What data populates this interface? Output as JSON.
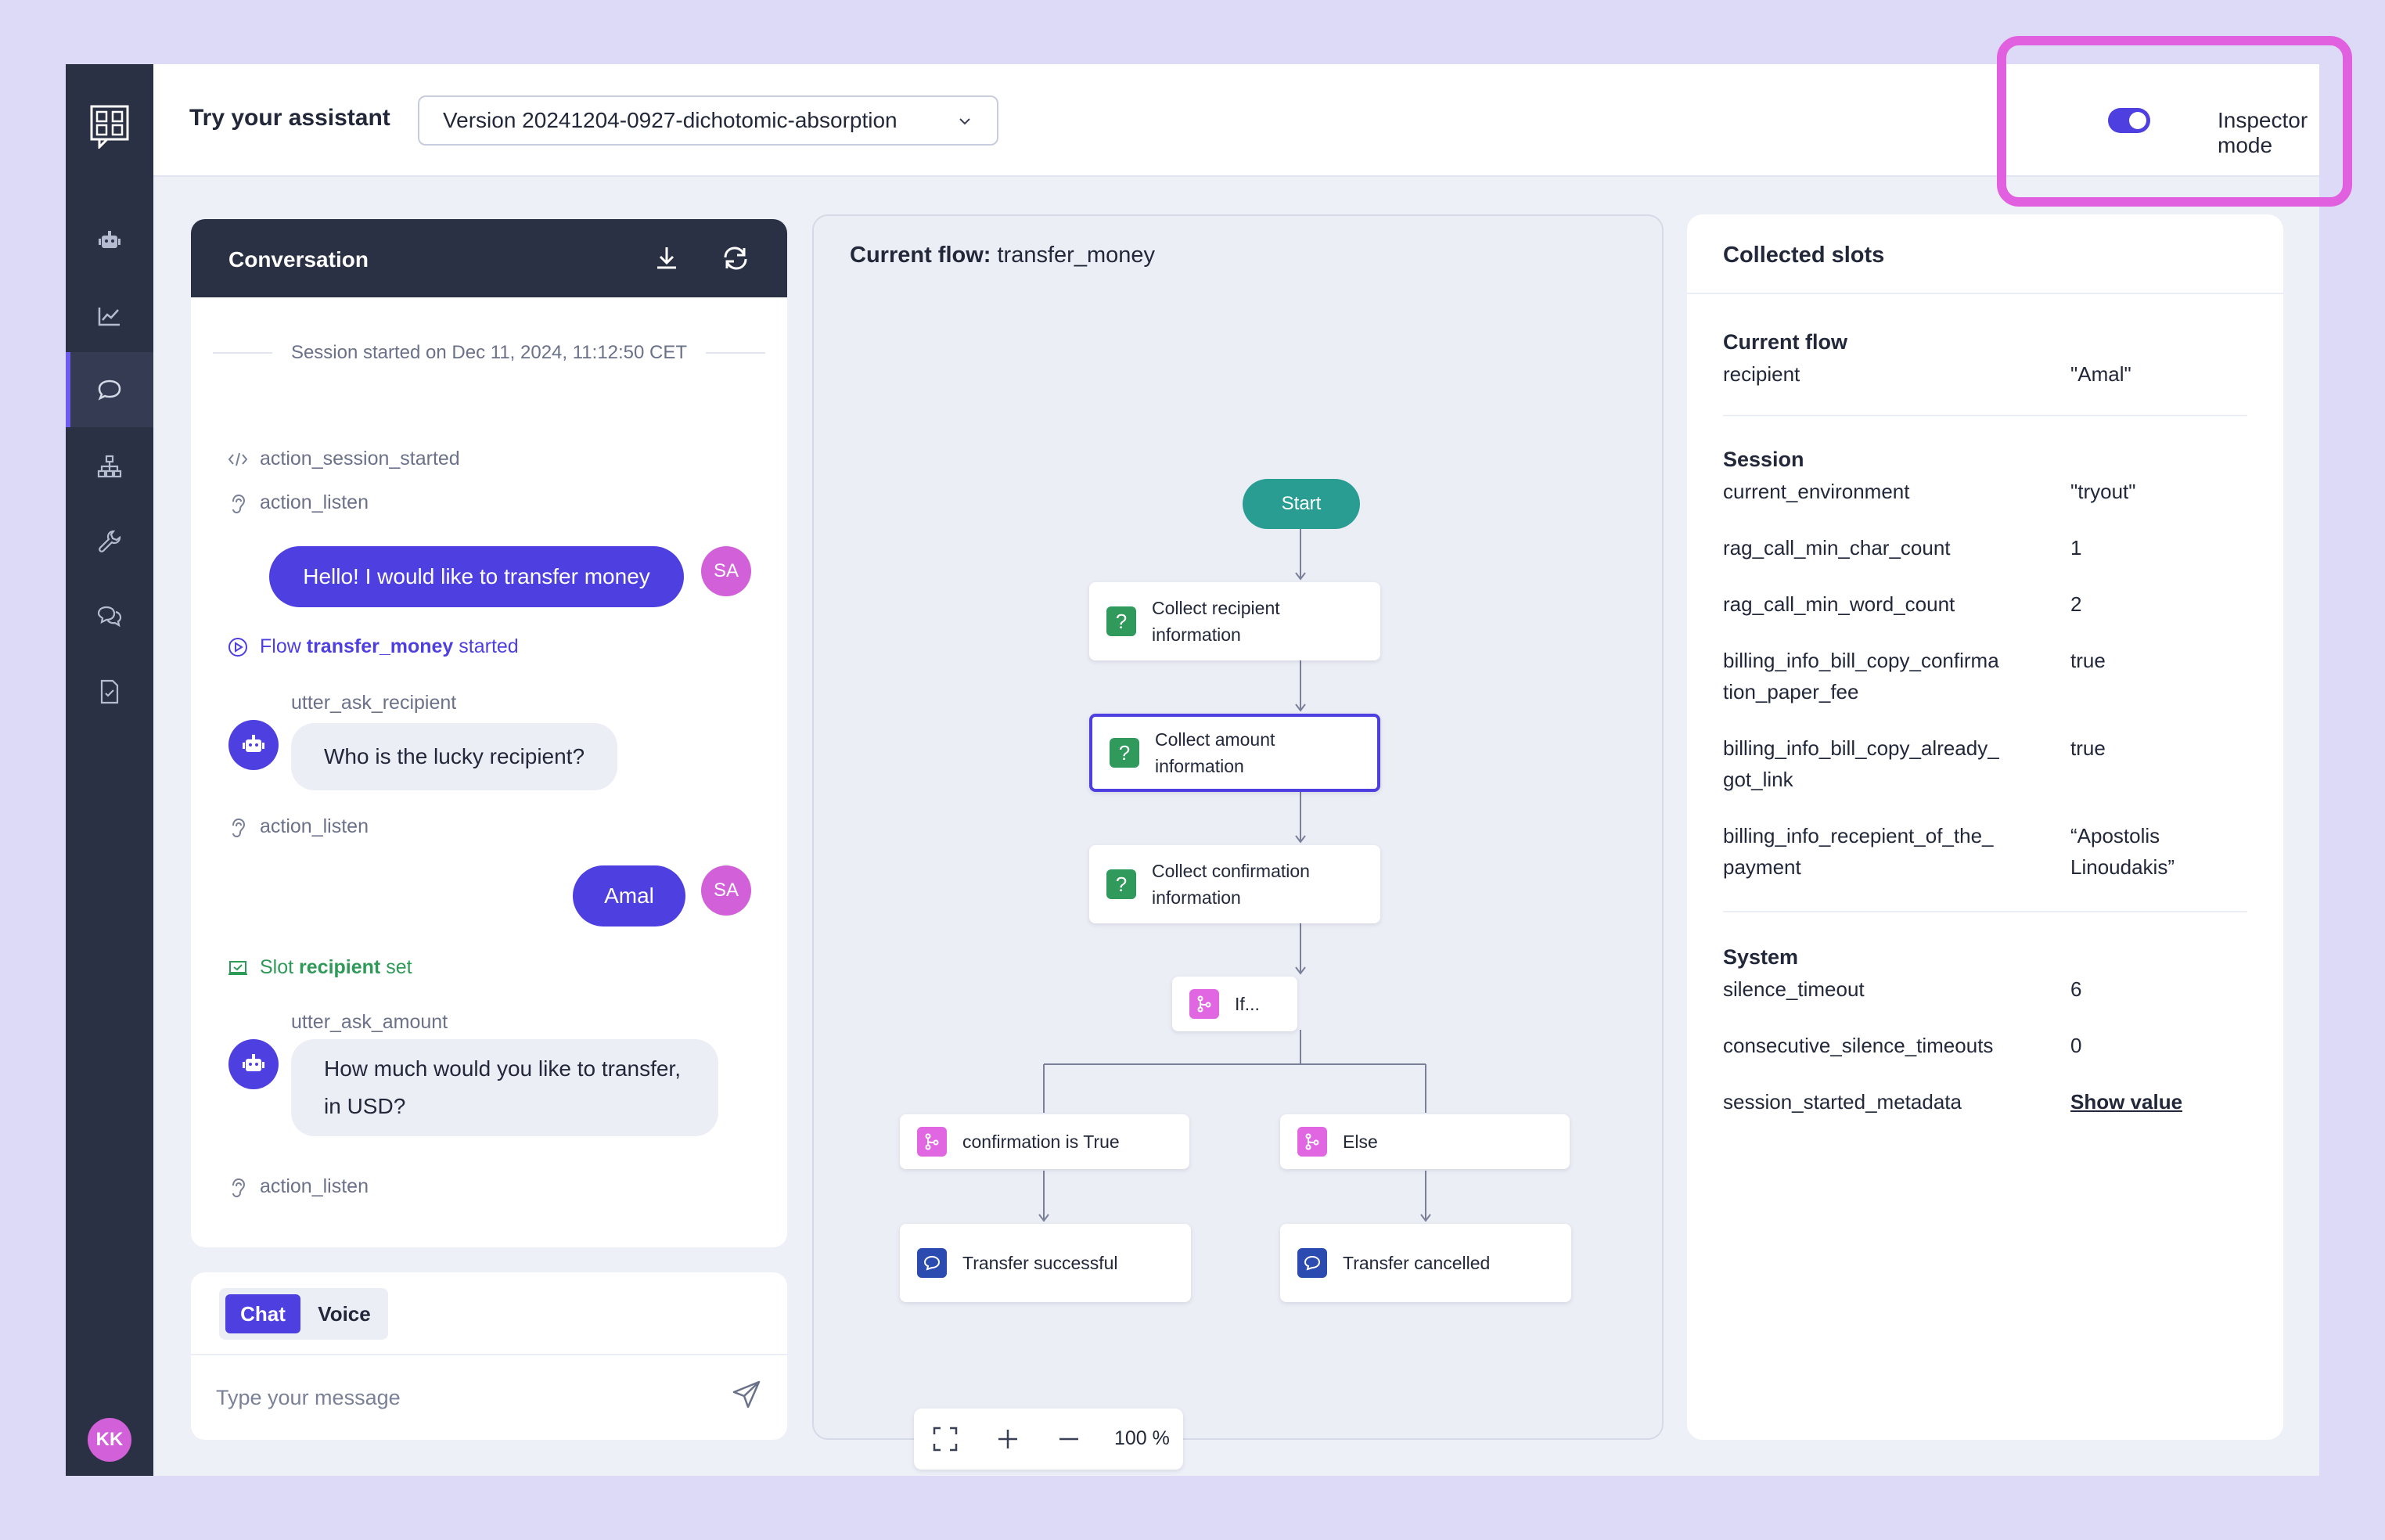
{
  "header": {
    "title": "Try your assistant",
    "version": "Version 20241204-0927-dichotomic-absorption",
    "inspector_label": "Inspector mode"
  },
  "sidebar": {
    "avatar_initials": "KK",
    "items": [
      "robot-icon",
      "chart-icon",
      "chat-icon",
      "flow-icon",
      "wrench-icon",
      "messages-icon",
      "document-icon"
    ]
  },
  "conversation": {
    "title": "Conversation",
    "session_started": "Session started on Dec 11, 2024, 11:12:50 CET",
    "events": {
      "action_session_started": "action_session_started",
      "action_listen": "action_listen",
      "flow_prefix": "Flow",
      "flow_name": "transfer_money",
      "flow_suffix": "started",
      "slot_prefix": "Slot",
      "slot_name": "recipient",
      "slot_suffix": "set"
    },
    "user_initials": "SA",
    "messages": {
      "user1": "Hello! I would like to transfer money",
      "bot1_label": "utter_ask_recipient",
      "bot1": "Who is the lucky recipient?",
      "user2": "Amal",
      "bot2_label": "utter_ask_amount",
      "bot2_line1": "How much would you like to transfer,",
      "bot2_line2": "in USD?"
    }
  },
  "input": {
    "chat_label": "Chat",
    "voice_label": "Voice",
    "placeholder": "Type your message"
  },
  "flow": {
    "title_prefix": "Current flow:",
    "title_name": "transfer_money",
    "start": "Start",
    "nodes": {
      "collect_recipient_1": "Collect recipient",
      "collect_recipient_2": "information",
      "collect_amount_1": "Collect amount",
      "collect_amount_2": "information",
      "collect_confirm_1": "Collect confirmation",
      "collect_confirm_2": "information",
      "if": "If...",
      "true_branch": "confirmation is True",
      "else_branch": "Else",
      "success": "Transfer successful",
      "cancelled": "Transfer cancelled"
    },
    "zoom": "100 %"
  },
  "slots": {
    "title": "Collected slots",
    "current_flow_title": "Current flow",
    "current_flow": [
      {
        "key": "recipient",
        "value": "\"Amal\""
      }
    ],
    "session_title": "Session",
    "session": [
      {
        "key": "current_environment",
        "value": "\"tryout\""
      },
      {
        "key": "rag_call_min_char_count",
        "value": "1"
      },
      {
        "key": "rag_call_min_word_count",
        "value": "2"
      },
      {
        "key": "billing_info_bill_copy_confirma tion_paper_fee",
        "value": "true"
      },
      {
        "key": "billing_info_bill_copy_already_ got_link",
        "value": "true"
      },
      {
        "key": "billing_info_recepient_of_the_ payment",
        "value": "“Apostolis Linoudakis”"
      }
    ],
    "system_title": "System",
    "system": [
      {
        "key": "silence_timeout",
        "value": "6"
      },
      {
        "key": "consecutive_silence_timeouts",
        "value": "0"
      },
      {
        "key": "session_started_metadata",
        "value": "Show value"
      }
    ]
  },
  "colors": {
    "accent": "#4e3fe0",
    "sidebar": "#2b3144",
    "highlight": "#e060e0",
    "start_node": "#2a9d92"
  }
}
